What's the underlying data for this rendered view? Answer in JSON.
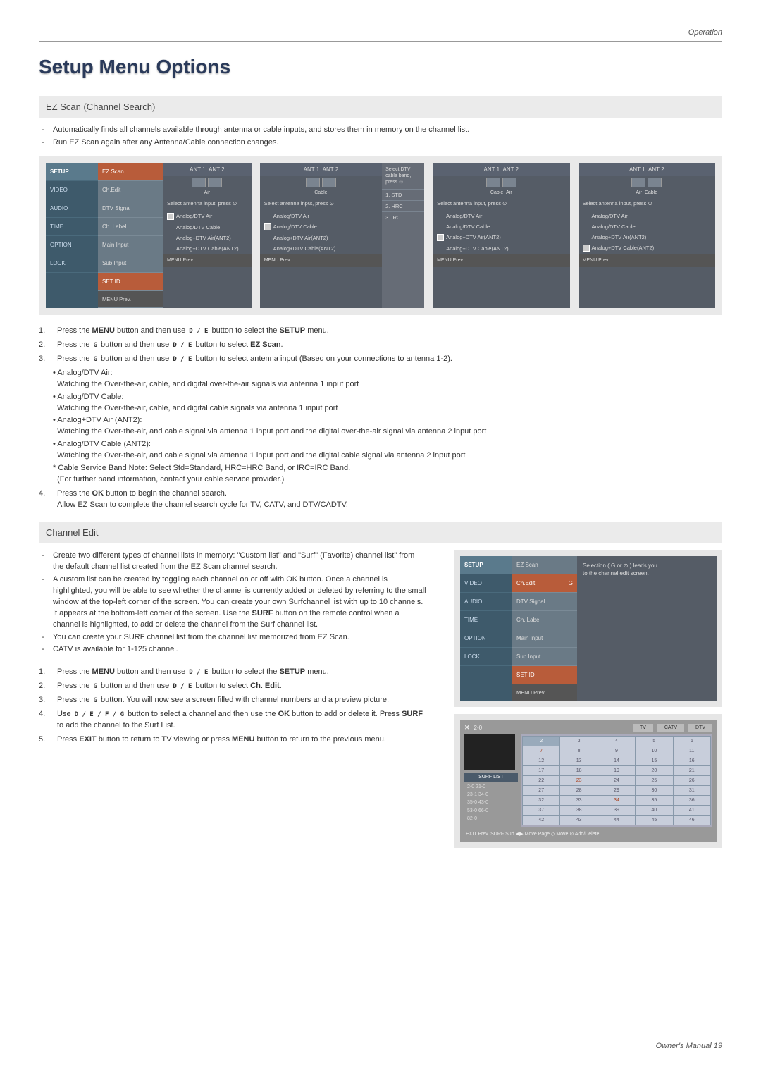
{
  "header": {
    "operation": "Operation",
    "title": "Setup Menu Options"
  },
  "footer": {
    "text": "Owner's Manual  19"
  },
  "section1": {
    "heading": "EZ Scan (Channel Search)",
    "intro1": "Automatically finds all channels available through antenna or cable inputs, and stores them in memory on the channel list.",
    "intro2": "Run EZ Scan again after any Antenna/Cable connection changes.",
    "step1a": "Press the ",
    "step1b": "MENU",
    "step1c": " button and then use ",
    "step1d": " button to select the ",
    "step1e": "SETUP",
    "step1f": " menu.",
    "step2a": "Press the ",
    "step2b": " button and then use ",
    "step2c": " button to select ",
    "step2d": "EZ Scan",
    "step3a": "Press the ",
    "step3b": " button and then use ",
    "step3c": " button to select antenna input (Based on your connections to antenna 1-2).",
    "b1t": "Analog/DTV Air:",
    "b1": "Watching the Over-the-air, cable, and digital over-the-air signals via antenna 1 input port",
    "b2t": "Analog/DTV Cable:",
    "b2": "Watching the Over-the-air, cable, and digital cable signals via antenna 1 input port",
    "b3t": "Analog+DTV Air (ANT2):",
    "b3": "Watching the Over-the-air, and cable signal via antenna 1 input port and the digital over-the-air signal via antenna 2 input port",
    "b4t": "Analog/DTV Cable (ANT2):",
    "b4": "Watching the Over-the-air, and cable signal via antenna 1 input port and the digital cable signal via antenna 2 input port",
    "note1": "Cable Service Band Note: Select Std=Standard, HRC=HRC Band, or IRC=IRC Band.",
    "note2": "(For further band information, contact your cable service provider.)",
    "step4a": "Press the ",
    "step4b": "OK",
    "step4c": " button to begin the channel search.",
    "step4d": "Allow EZ Scan to complete the channel search cycle for TV, CATV, and DTV/CADTV."
  },
  "nav": {
    "setup": "SETUP",
    "video": "VIDEO",
    "audio": "AUDIO",
    "time": "TIME",
    "option": "OPTION",
    "lock": "LOCK"
  },
  "setupList": {
    "ez": "EZ Scan",
    "ch": "Ch.Edit",
    "dtv": "DTV Signal",
    "lbl": "Ch. Label",
    "main": "Main Input",
    "sub": "Sub Input",
    "setid": "SET ID",
    "prev": "MENU   Prev."
  },
  "ant": {
    "a1": "ANT 1",
    "a2": "ANT 2",
    "air": "Air",
    "cable": "Cable",
    "sel": "Select antenna input, press ⊙",
    "selband": "Select DTV cable band, press ⊙",
    "o1": "Analog/DTV Air",
    "o2": "Analog/DTV Cable",
    "o3": "Analog+DTV Air(ANT2)",
    "o4": "Analog+DTV Cable(ANT2)",
    "prev": "MENU   Prev.",
    "std": "1. STD",
    "hrc": "2. HRC",
    "irc": "3. IRC"
  },
  "section2": {
    "heading": "Channel Edit",
    "p1": "Create two different types of channel lists in memory: \"Custom list\" and \"Surf\" (Favorite) channel list\" from the default channel list created from the EZ Scan channel search.",
    "p2": "A custom list can be created by toggling each channel on or off with OK button. Once a channel is highlighted, you will be able to see whether the channel is currently added or deleted by referring to the small window at the top-left corner of the screen. You can create your own Surfchannel list with up to 10 channels. It appears at the bottom-left corner of the screen. Use the ",
    "p2b": "SURF",
    "p2c": " button on the remote control when a channel is highlighted, to add or delete the channel from the Surf channel list.",
    "p3": "You can create your SURF channel list from the channel list memorized from EZ Scan.",
    "p4": "CATV is available for 1-125 channel.",
    "s1a": "Press the ",
    "s1b": "MENU",
    "s1c": " button and then use ",
    "s1d": " button to select the ",
    "s1e": "SETUP",
    "s1f": " menu.",
    "s2a": "Press the ",
    "s2b": " button and then use ",
    "s2c": " button to select ",
    "s2d": "Ch. Edit",
    "s3a": "Press the ",
    "s3b": " button. You will now see a screen filled with channel numbers and a preview picture.",
    "s4a": "Use ",
    "s4b": "button to select a channel and then use the ",
    "s4c": "OK",
    "s4d": " button to add or delete it. Press ",
    "s4e": "SURF",
    "s4f": " to add the channel to the Surf List.",
    "s5a": "Press ",
    "s5b": "EXIT",
    "s5c": " button to return to TV viewing or press ",
    "s5d": "MENU",
    "s5e": " button to return to the previous menu.",
    "hint1": "Selection ( G or ⊙ ) leads you",
    "hint2": "to the channel edit screen.",
    "chG": "G"
  },
  "grid": {
    "corner": "2-0",
    "tv": "TV",
    "catv": "CATV",
    "dtv": "DTV",
    "surf": "SURF LIST",
    "sitems": "2-0    21-0\n23-1   34-0\n35-0   43-0\n53-0   66-0\n82-0",
    "rows": [
      [
        "2",
        "3",
        "4",
        "5",
        "6"
      ],
      [
        "7",
        "8",
        "9",
        "10",
        "11"
      ],
      [
        "12",
        "13",
        "14",
        "15",
        "16"
      ],
      [
        "17",
        "18",
        "19",
        "20",
        "21"
      ],
      [
        "22",
        "23",
        "24",
        "25",
        "26"
      ],
      [
        "27",
        "28",
        "29",
        "30",
        "31"
      ],
      [
        "32",
        "33",
        "34",
        "35",
        "36"
      ],
      [
        "37",
        "38",
        "39",
        "40",
        "41"
      ],
      [
        "42",
        "43",
        "44",
        "45",
        "46"
      ]
    ],
    "bottom": "EXIT Prev.    SURF Surf    ◀▶ Move Page    ◇ Move    ⊙ Add/Delete"
  },
  "keys": {
    "de": "D / E",
    "g": "G",
    "defg": "D / E / F / G"
  }
}
